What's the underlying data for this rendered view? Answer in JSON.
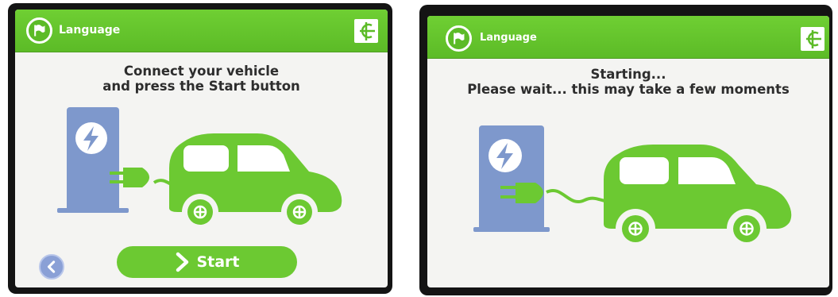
{
  "colors": {
    "accent_green": "#6cc932",
    "charger_blue": "#7e98cc",
    "text_dark": "#2d2d2d"
  },
  "screens": [
    {
      "header": {
        "language_label": "Language",
        "language_icon": "flag-icon",
        "logo_icon": "brand-logo-icon"
      },
      "message": {
        "line1": "Connect your vehicle",
        "line2": "and press the Start button"
      },
      "footer": {
        "back_icon": "chevron-left-icon",
        "start_label": "Start",
        "start_icon": "chevron-right-icon"
      }
    },
    {
      "header": {
        "language_label": "Language",
        "language_icon": "flag-icon",
        "logo_icon": "brand-logo-icon"
      },
      "message": {
        "line1": "Starting...",
        "line2": "Please wait... this may take a few moments"
      }
    }
  ]
}
